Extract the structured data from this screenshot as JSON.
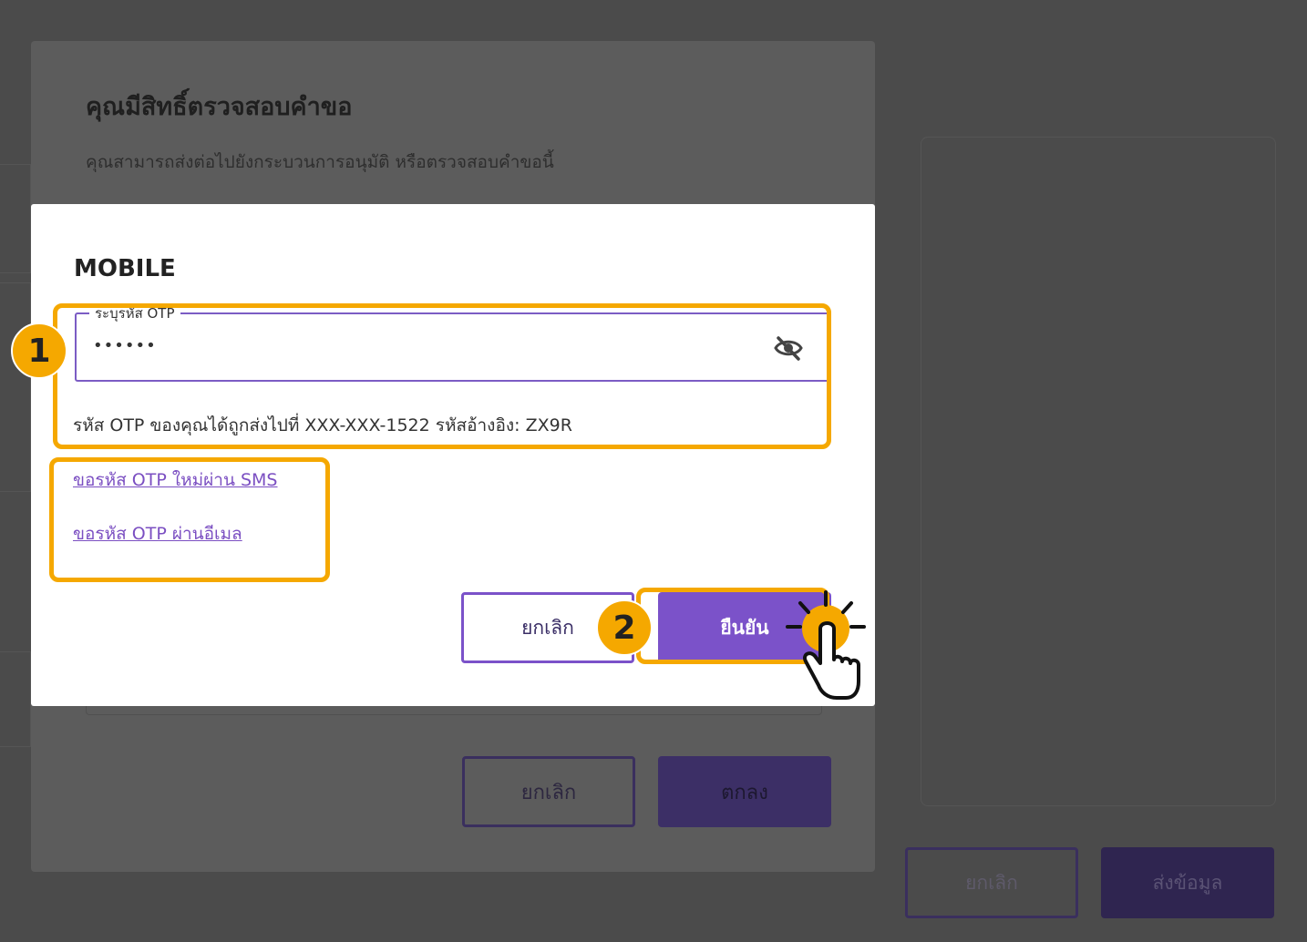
{
  "background": {
    "cancel_label": "ยกเลิก",
    "submit_label": "ส่งข้อมูล"
  },
  "review_dialog": {
    "title": "คุณมีสิทธิ์ตรวจสอบคำขอ",
    "subtitle": "คุณสามารถส่งต่อไปยังกระบวนการอนุมัติ หรือตรวจสอบคำขอนี้",
    "cancel_label": "ยกเลิก",
    "ok_label": "ตกลง"
  },
  "otp_dialog": {
    "title": "MOBILE",
    "otp_field": {
      "label": "ระบุรหัส OTP",
      "value": "••••••",
      "toggle_icon": "eye-off-icon"
    },
    "helper_text": "รหัส OTP ของคุณได้ถูกส่งไปที่ XXX-XXX-1522 รหัสอ้างอิง: ZX9R",
    "resend_sms_link": "ขอรหัส OTP ใหม่ผ่าน SMS",
    "resend_email_link": "ขอรหัส OTP ผ่านอีเมล",
    "cancel_label": "ยกเลิก",
    "confirm_label": "ยืนยัน"
  },
  "annotations": {
    "step_1": "1",
    "step_2": "2",
    "highlight_color": "#f5a800"
  },
  "colors": {
    "accent": "#7b52c9",
    "overlay": "#4b4b4b"
  }
}
